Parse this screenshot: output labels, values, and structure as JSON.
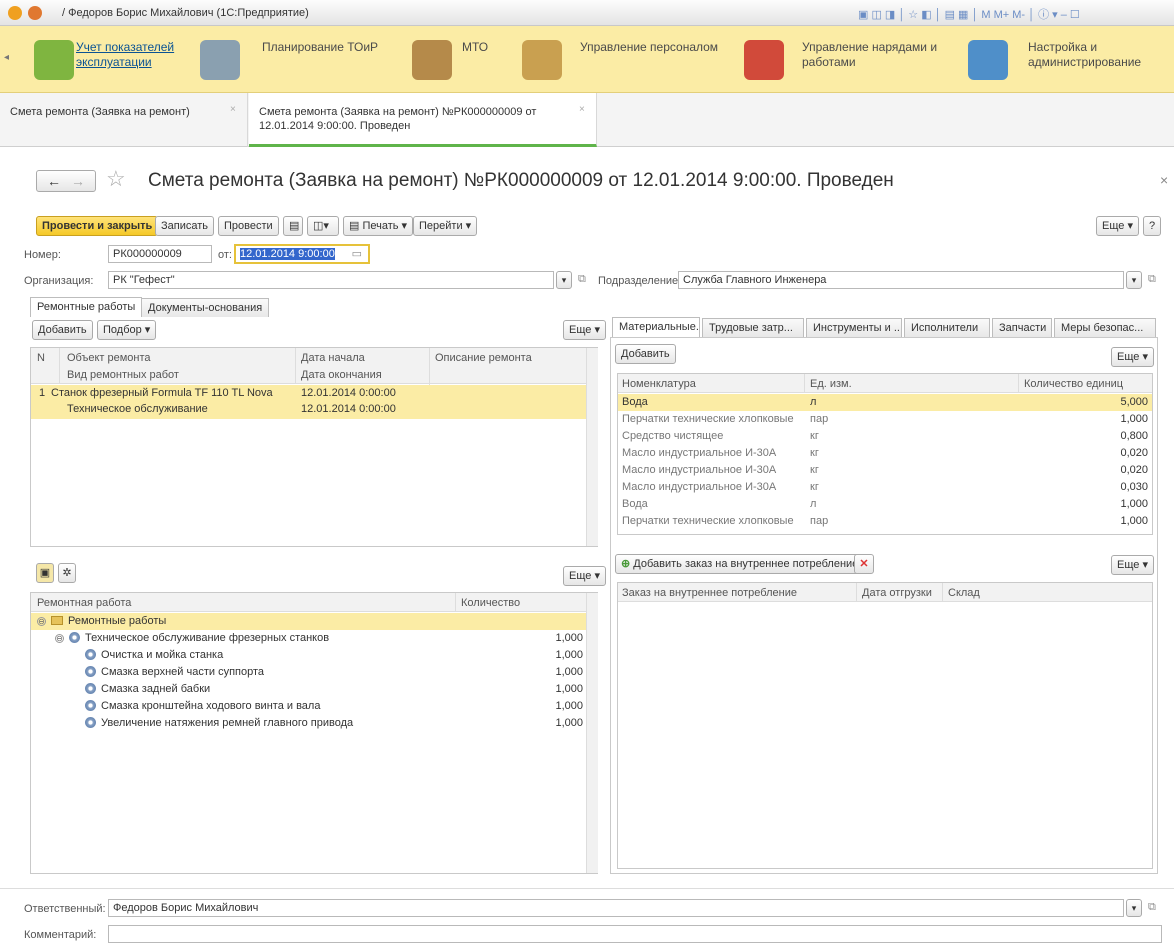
{
  "window": {
    "title": "/ Федоров Борис Михайлович  (1С:Предприятие)"
  },
  "sections": [
    {
      "label": "Учет показателей эксплуатации",
      "color": "#7fb540"
    },
    {
      "label": "Планирование ТОиР",
      "color": "#8aa0b0"
    },
    {
      "label": "МТО",
      "color": "#b58a4a"
    },
    {
      "label": "Управление персоналом",
      "color": "#c9a050"
    },
    {
      "label": "Управление нарядами и работами",
      "color": "#d14a3a"
    },
    {
      "label": "Настройка и администрирование",
      "color": "#4f8fc9"
    }
  ],
  "open_tabs": [
    {
      "label": "Смета ремонта (Заявка на ремонт)"
    },
    {
      "label": "Смета ремонта (Заявка на ремонт) №РК000000009 от 12.01.2014 9:00:00. Проведен"
    }
  ],
  "doc": {
    "title": "Смета ремонта (Заявка на ремонт) №РК000000009 от 12.01.2014 9:00:00. Проведен",
    "nav_back": "←",
    "nav_fwd": "→",
    "star": "☆",
    "close": "×"
  },
  "toolbar": {
    "post_close": "Провести и закрыть",
    "save": "Записать",
    "post": "Провести",
    "print": "Печать",
    "goto": "Перейти",
    "more": "Еще",
    "help": "?"
  },
  "header": {
    "number_label": "Номер:",
    "number_value": "РК000000009",
    "from_label": "от:",
    "date_value": "12.01.2014  9:00:00",
    "org_label": "Организация:",
    "org_value": "РК \"Гефест\"",
    "dept_label": "Подразделение:",
    "dept_value": "Служба Главного Инженера"
  },
  "main_tabs": [
    "Ремонтные работы",
    "Документы-основания"
  ],
  "works": {
    "add": "Добавить",
    "pick": "Подбор",
    "more": "Еще",
    "columns": [
      "N",
      "Объект ремонта",
      "Дата начала",
      "Описание ремонта"
    ],
    "columns2": [
      "Вид ремонтных работ",
      "Дата окончания"
    ],
    "rows": [
      {
        "n": "1",
        "object": "Станок фрезерный Formula TF 110 TL Nova",
        "start": "12.01.2014 0:00:00",
        "type": "Техническое обслуживание",
        "end": "12.01.2014 0:00:00"
      }
    ]
  },
  "tree": {
    "more": "Еще",
    "columns": [
      "Ремонтная работа",
      "Количество"
    ],
    "rows": [
      {
        "label": "Ремонтные работы",
        "qty": "",
        "level": 0,
        "kind": "folder",
        "toggle": "⊖"
      },
      {
        "label": "Техническое обслуживание фрезерных станков",
        "qty": "1,000",
        "level": 1,
        "kind": "group",
        "toggle": "⊖"
      },
      {
        "label": "Очистка и мойка станка",
        "qty": "1,000",
        "level": 2,
        "kind": "item",
        "toggle": ""
      },
      {
        "label": "Смазка верхней части суппорта",
        "qty": "1,000",
        "level": 2,
        "kind": "item",
        "toggle": ""
      },
      {
        "label": "Смазка задней бабки",
        "qty": "1,000",
        "level": 2,
        "kind": "item",
        "toggle": ""
      },
      {
        "label": "Смазка кронштейна ходового винта и вала",
        "qty": "1,000",
        "level": 2,
        "kind": "item",
        "toggle": ""
      },
      {
        "label": "Увеличение натяжения ремней главного привода",
        "qty": "1,000",
        "level": 2,
        "kind": "item",
        "toggle": ""
      }
    ]
  },
  "right_tabs": [
    "Материальные...",
    "Трудовые затр...",
    "Инструменты и ...",
    "Исполнители",
    "Запчасти",
    "Меры безопас..."
  ],
  "materials": {
    "add": "Добавить",
    "more": "Еще",
    "columns": [
      "Номенклатура",
      "Ед. изм.",
      "Количество единиц"
    ],
    "rows": [
      {
        "name": "Вода",
        "unit": "л",
        "qty": "5,000"
      },
      {
        "name": "Перчатки технические хлопковые",
        "unit": "пар",
        "qty": "1,000"
      },
      {
        "name": "Средство чистящее",
        "unit": "кг",
        "qty": "0,800"
      },
      {
        "name": "Масло индустриальное И-30А",
        "unit": "кг",
        "qty": "0,020"
      },
      {
        "name": "Масло индустриальное И-30А",
        "unit": "кг",
        "qty": "0,020"
      },
      {
        "name": "Масло индустриальное И-30А",
        "unit": "кг",
        "qty": "0,030"
      },
      {
        "name": "Вода",
        "unit": "л",
        "qty": "1,000"
      },
      {
        "name": "Перчатки технические хлопковые",
        "unit": "пар",
        "qty": "1,000"
      }
    ]
  },
  "orders": {
    "add": "Добавить заказ на внутреннее потребление",
    "more": "Еще",
    "columns": [
      "Заказ на внутреннее потребление",
      "Дата отгрузки",
      "Склад"
    ]
  },
  "footer": {
    "resp_label": "Ответственный:",
    "resp_value": "Федоров Борис Михайлович",
    "comment_label": "Комментарий:",
    "comment_value": ""
  }
}
